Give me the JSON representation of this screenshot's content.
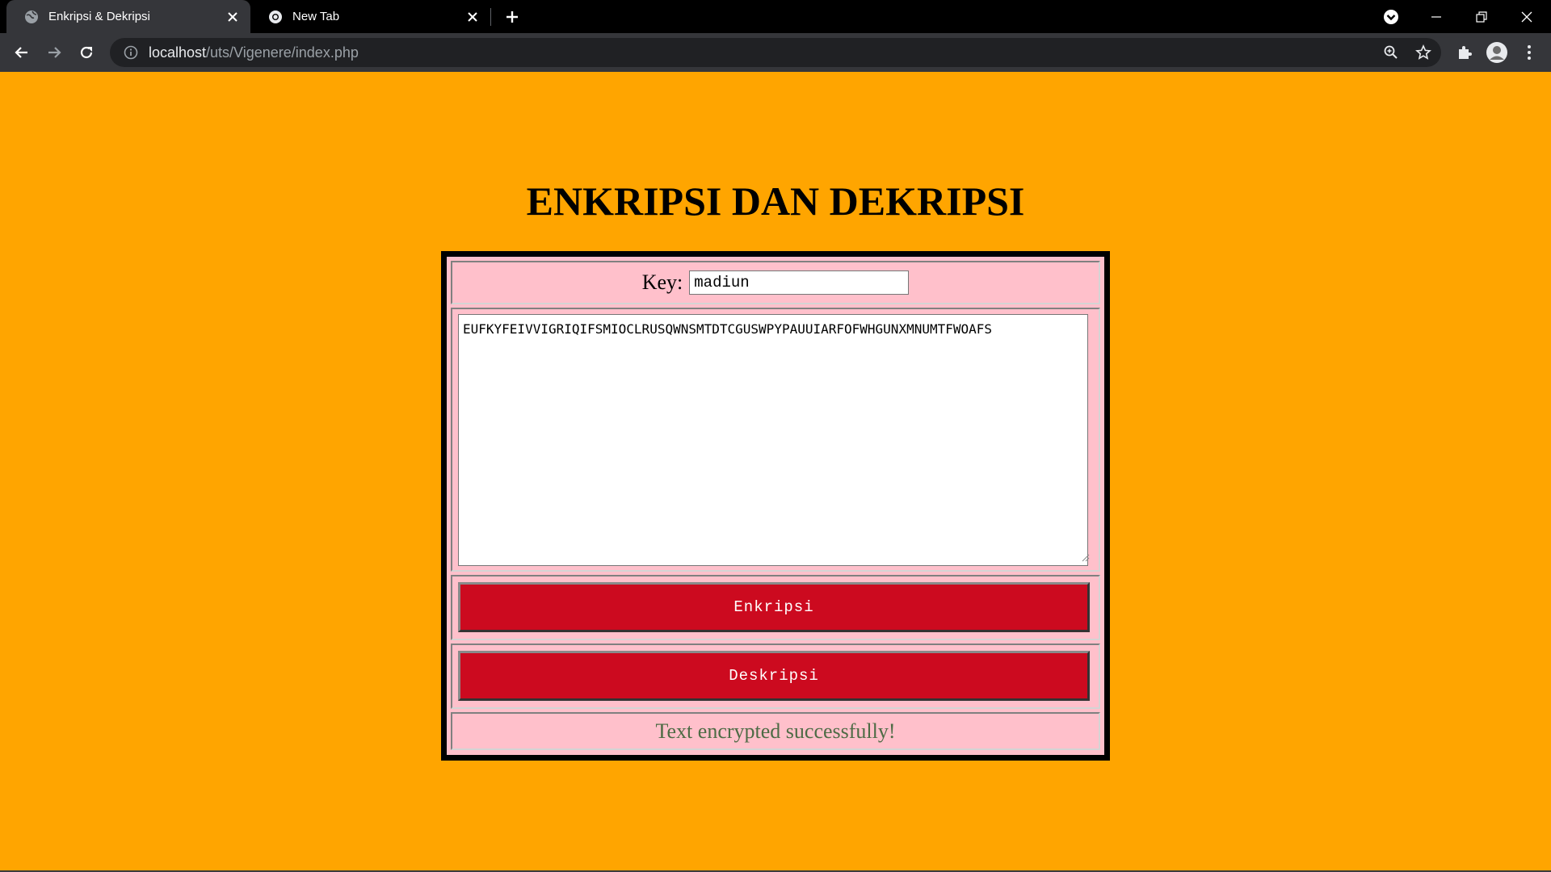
{
  "browser": {
    "tabs": [
      {
        "title": "Enkripsi & Dekripsi",
        "active": true
      },
      {
        "title": "New Tab",
        "active": false
      }
    ],
    "url_host": "localhost",
    "url_path": "/uts/Vigenere/index.php"
  },
  "page": {
    "heading": "ENKRIPSI DAN DEKRIPSI",
    "key_label": "Key:",
    "key_value": "madiun",
    "text_value": "EUFKYFEIVVIGRIQIFSMIOCLRUSQWNSMTDTCGUSWPYPAUUIARFOFWHGUNXMNUMTFWOAFS",
    "encrypt_label": "Enkripsi",
    "decrypt_label": "Deskripsi",
    "status_message": "Text encrypted successfully!"
  },
  "colors": {
    "page_background": "#ffa500",
    "form_background": "#ffc0cb",
    "button_background": "#cc0a1f",
    "status_text": "#4d6b45"
  }
}
